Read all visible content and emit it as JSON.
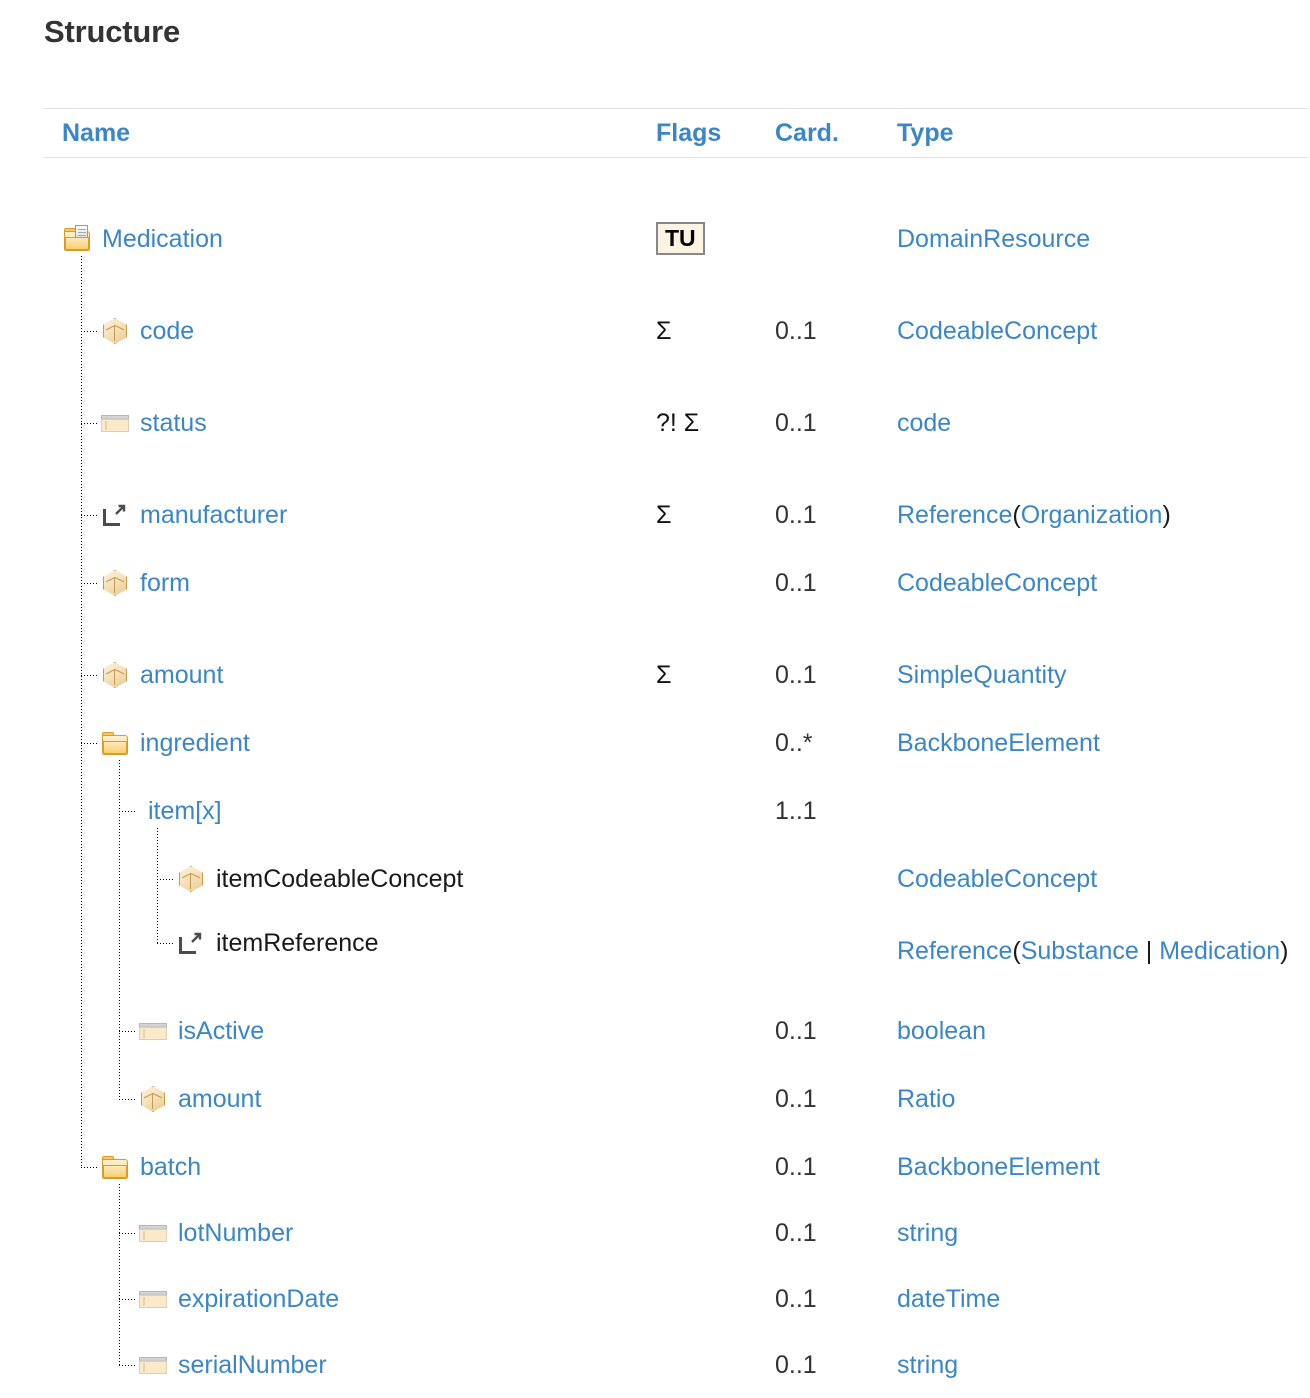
{
  "title": "Structure",
  "colors": {
    "link_blue": "#3b86c8",
    "heading_gray": "#333333",
    "flag_box_bg": "#fdf3e3",
    "flag_box_border": "#888888",
    "icon_folder": "#f3c96a",
    "icon_datatype": "#f0dcb4",
    "icon_primitive": "#fbe9ca",
    "icon_choice": "#4ea3e0"
  },
  "table": {
    "headers": {
      "name": "Name",
      "flags": "Flags",
      "card": "Card.",
      "type": "Type"
    },
    "rows": [
      {
        "name": "Medication",
        "icon": "resource-folder-icon",
        "indent": 0,
        "flags_box": "TU",
        "flags": "",
        "card": "",
        "type_parts": [
          {
            "t": "DomainResource",
            "link": true
          }
        ]
      },
      {
        "name": "code",
        "icon": "datatype-cube-icon",
        "indent": 1,
        "flags_box": "",
        "flags": "Σ",
        "card": "0..1",
        "type_parts": [
          {
            "t": "CodeableConcept",
            "link": true
          }
        ]
      },
      {
        "name": "status",
        "icon": "primitive-icon",
        "indent": 1,
        "flags_box": "",
        "flags": "?! Σ",
        "card": "0..1",
        "type_parts": [
          {
            "t": "code",
            "link": true
          }
        ]
      },
      {
        "name": "manufacturer",
        "icon": "reference-icon",
        "indent": 1,
        "flags_box": "",
        "flags": "Σ",
        "card": "0..1",
        "type_parts": [
          {
            "t": "Reference",
            "link": true
          },
          {
            "t": "(",
            "link": false
          },
          {
            "t": "Organization",
            "link": true
          },
          {
            "t": ")",
            "link": false
          }
        ]
      },
      {
        "name": "form",
        "icon": "datatype-cube-icon",
        "indent": 1,
        "flags_box": "",
        "flags": "",
        "card": "0..1",
        "type_parts": [
          {
            "t": "CodeableConcept",
            "link": true
          }
        ]
      },
      {
        "name": "amount",
        "icon": "datatype-cube-icon",
        "indent": 1,
        "flags_box": "",
        "flags": "Σ",
        "card": "0..1",
        "type_parts": [
          {
            "t": "SimpleQuantity",
            "link": true
          }
        ]
      },
      {
        "name": "ingredient",
        "icon": "backbone-folder-icon",
        "indent": 1,
        "flags_box": "",
        "flags": "",
        "card": "0..*",
        "type_parts": [
          {
            "t": "BackboneElement",
            "link": true
          }
        ]
      },
      {
        "name": "item[x]",
        "icon": "choice-icon",
        "indent": 2,
        "flags_box": "",
        "flags": "",
        "card": "1..1",
        "type_parts": []
      },
      {
        "name": "itemCodeableConcept",
        "icon": "datatype-cube-icon",
        "indent": 3,
        "plain": true,
        "flags_box": "",
        "flags": "",
        "card": "",
        "type_parts": [
          {
            "t": "CodeableConcept",
            "link": true
          }
        ]
      },
      {
        "name": "itemReference",
        "icon": "reference-icon",
        "indent": 3,
        "plain": true,
        "flags_box": "",
        "flags": "",
        "card": "",
        "type_parts": [
          {
            "t": "Reference",
            "link": true
          },
          {
            "t": "(",
            "link": false
          },
          {
            "t": "Substance",
            "link": true
          },
          {
            "t": " | ",
            "link": false
          },
          {
            "t": "Medication",
            "link": true
          },
          {
            "t": ")",
            "link": false
          }
        ],
        "type_wrap": true
      },
      {
        "name": "isActive",
        "icon": "primitive-icon",
        "indent": 2,
        "flags_box": "",
        "flags": "",
        "card": "0..1",
        "type_parts": [
          {
            "t": "boolean",
            "link": true
          }
        ]
      },
      {
        "name": "amount",
        "icon": "datatype-cube-icon",
        "indent": 2,
        "flags_box": "",
        "flags": "",
        "card": "0..1",
        "type_parts": [
          {
            "t": "Ratio",
            "link": true
          }
        ]
      },
      {
        "name": "batch",
        "icon": "backbone-folder-icon",
        "indent": 1,
        "flags_box": "",
        "flags": "",
        "card": "0..1",
        "type_parts": [
          {
            "t": "BackboneElement",
            "link": true
          }
        ]
      },
      {
        "name": "lotNumber",
        "icon": "primitive-icon",
        "indent": 2,
        "flags_box": "",
        "flags": "",
        "card": "0..1",
        "type_parts": [
          {
            "t": "string",
            "link": true
          }
        ]
      },
      {
        "name": "expirationDate",
        "icon": "primitive-icon",
        "indent": 2,
        "flags_box": "",
        "flags": "",
        "card": "0..1",
        "type_parts": [
          {
            "t": "dateTime",
            "link": true
          }
        ]
      },
      {
        "name": "serialNumber",
        "icon": "primitive-icon",
        "indent": 2,
        "flags_box": "",
        "flags": "",
        "card": "0..1",
        "type_parts": [
          {
            "t": "string",
            "link": true
          }
        ]
      }
    ]
  }
}
